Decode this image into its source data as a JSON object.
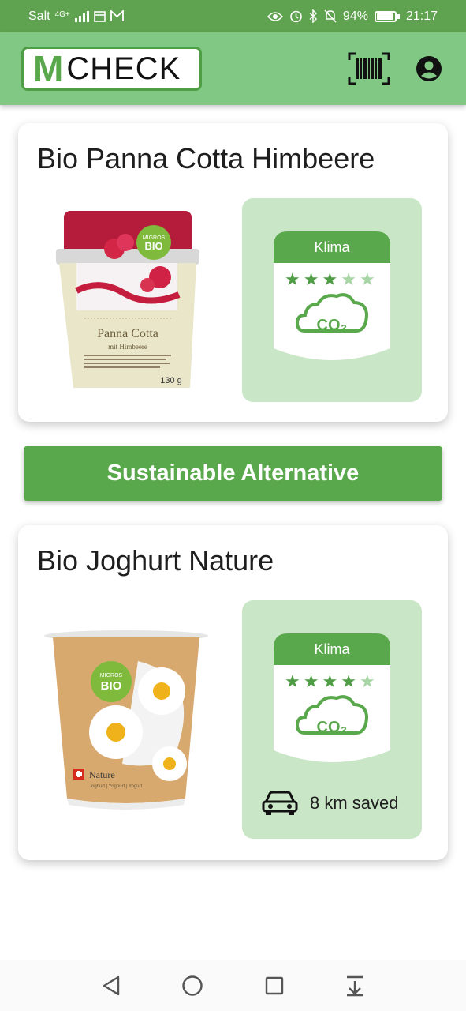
{
  "status_bar": {
    "carrier": "Salt",
    "network": "4G",
    "network_sup": "+",
    "battery_percent": "94%",
    "time": "21:17"
  },
  "app_bar": {
    "logo_m": "M",
    "logo_text": "CHECK",
    "barcode_icon": "barcode-scan-icon",
    "account_icon": "account-circle-icon"
  },
  "products": [
    {
      "title": "Bio Panna Cotta Himbeere",
      "image": {
        "kind": "panna-cotta-cup",
        "label_line1": "Panna Cotta",
        "label_line2": "mit Himbeere",
        "badge_top": "MIGROS",
        "badge_main": "BIO",
        "weight": "130 g"
      },
      "rating_label": "Klima",
      "stars_filled": 3,
      "stars_total": 5,
      "co2_label": "CO₂"
    },
    {
      "title": "Bio Joghurt Nature",
      "image": {
        "kind": "yogurt-cup",
        "label_line1": "Nature",
        "label_line2": "Joghurt | Yogourt | Yogurt",
        "badge_top": "MIGROS",
        "badge_main": "BIO"
      },
      "rating_label": "Klima",
      "stars_filled": 4,
      "stars_total": 5,
      "co2_label": "CO₂",
      "savings_icon": "car-icon",
      "savings_text": "8 km saved"
    }
  ],
  "alternative_button_label": "Sustainable Alternative",
  "nav_bar": {
    "back_icon": "back-triangle-icon",
    "home_icon": "home-circle-icon",
    "recents_icon": "recents-square-icon",
    "notifications_icon": "pull-down-icon"
  },
  "colors": {
    "status_bar": "#5fa24f",
    "app_bar": "#80c884",
    "brand_green": "#5aa84c",
    "panel_green": "#c9e6c6",
    "star_empty": "#a8d5a5"
  }
}
